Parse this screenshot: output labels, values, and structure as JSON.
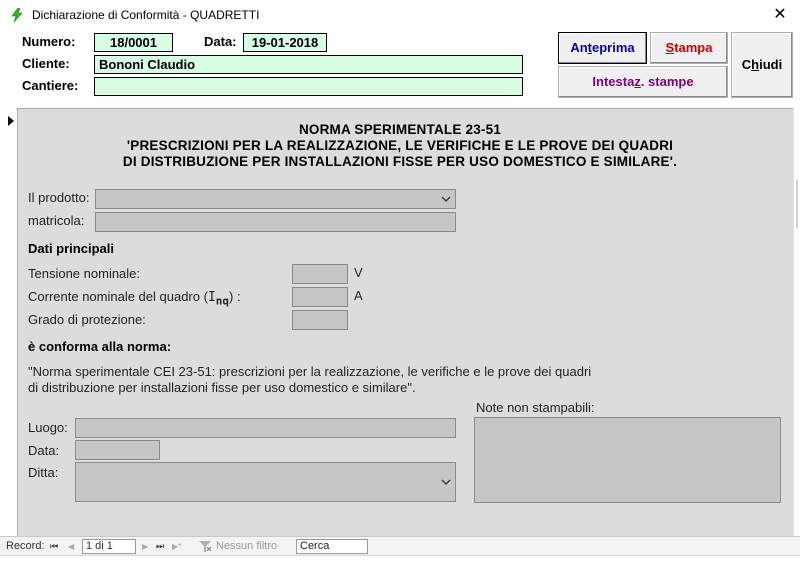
{
  "window": {
    "title": "Dichiarazione di Conformità  -  QUADRETTI",
    "close_glyph": "✕"
  },
  "header": {
    "numero_label": "Numero:",
    "numero_value": "18/0001",
    "data_label": "Data:",
    "data_value": "19-01-2018",
    "cliente_label": "Cliente:",
    "cliente_value": "Bononi Claudio",
    "cantiere_label": "Cantiere:",
    "cantiere_value": "",
    "buttons": {
      "anteprima_pre": "An",
      "anteprima_accel": "t",
      "anteprima_post": "eprima",
      "stampa_pre": "",
      "stampa_accel": "S",
      "stampa_post": "tampa",
      "intestaz_pre": "Intesta",
      "intestaz_accel": "z",
      "intestaz_post": ". stampe",
      "chiudi_pre": "C",
      "chiudi_accel": "h",
      "chiudi_post": "iudi"
    },
    "colors": {
      "field_bg": "#d7fde2",
      "anteprima": "#0000cc",
      "stampa": "#cc0000",
      "intestaz": "#800080"
    }
  },
  "norma": {
    "line1": "NORMA SPERIMENTALE 23-51",
    "line2": "'PRESCRIZIONI PER LA REALIZZAZIONE, LE VERIFICHE E LE PROVE DEI QUADRI",
    "line3": "DI DISTRIBUZIONE PER INSTALLAZIONI FISSE PER USO DOMESTICO E SIMILARE'."
  },
  "form": {
    "prodotto_label": "Il prodotto:",
    "prodotto_value": "",
    "matricola_label": "matricola:",
    "matricola_value": "",
    "dati_principali": "Dati principali",
    "tensione_label": "Tensione nominale:",
    "tensione_value": "",
    "tensione_unit": "V",
    "corrente_label": "Corrente nominale del quadro (",
    "corrente_sym_i": "I",
    "corrente_sym_sub": "nq",
    "corrente_label_end": ") :",
    "corrente_value": "",
    "corrente_unit": "A",
    "grado_label": "Grado di protezione:",
    "grado_value": "",
    "conforme_heading": "è conforma alla norma:",
    "quote_line1": "\"Norma sperimentale CEI 23-51: prescrizioni per la realizzazione, le verifiche e le prove dei quadri",
    "quote_line2": "di distribuzione per installazioni fisse per uso domestico e similare\".",
    "luogo_label": "Luogo:",
    "data_label": "Data:",
    "ditta_label": "Ditta:",
    "note_label": "Note non stampabili:"
  },
  "recordbar": {
    "record_label": "Record:",
    "first": "⏮",
    "prev": "◀",
    "current": "1 di 1",
    "next": "▶",
    "last": "⏭",
    "new": "▶*",
    "filter_label": "Nessun filtro",
    "search_placeholder": "Cerca"
  }
}
